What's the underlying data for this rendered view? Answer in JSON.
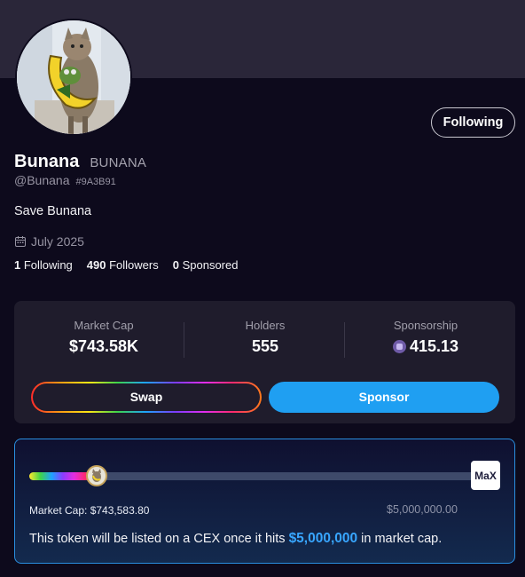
{
  "profile": {
    "follow_button": "Following",
    "name": "Bunana",
    "ticker": "BUNANA",
    "handle": "@Bunana",
    "id": "#9A3B91",
    "bio": "Save Bunana",
    "joined": "July 2025",
    "stats": {
      "following_count": "1",
      "following_label": "Following",
      "followers_count": "490",
      "followers_label": "Followers",
      "sponsored_count": "0",
      "sponsored_label": "Sponsored"
    },
    "icons": [
      "cat-avatar",
      "calendar-icon"
    ]
  },
  "metrics": {
    "market_cap_label": "Market Cap",
    "market_cap_value": "$743.58K",
    "holders_label": "Holders",
    "holders_value": "555",
    "sponsorship_label": "Sponsorship",
    "sponsorship_value": "415.13",
    "swap_label": "Swap",
    "sponsor_label": "Sponsor"
  },
  "cex": {
    "progress_fraction": 0.1487,
    "market_cap_text": "Market Cap: $743,583.80",
    "goal_text": "$5,000,000.00",
    "max_logo_text": "MaX",
    "message_prefix": "This token will be listed on a CEX once it hits ",
    "message_amount": "$5,000,000",
    "message_suffix": " in market cap."
  },
  "colors": {
    "background": "#0d0a1c",
    "accent_blue": "#1f9ff2",
    "highlight_blue": "#38a6ff",
    "panel": "#1f1c2c"
  }
}
